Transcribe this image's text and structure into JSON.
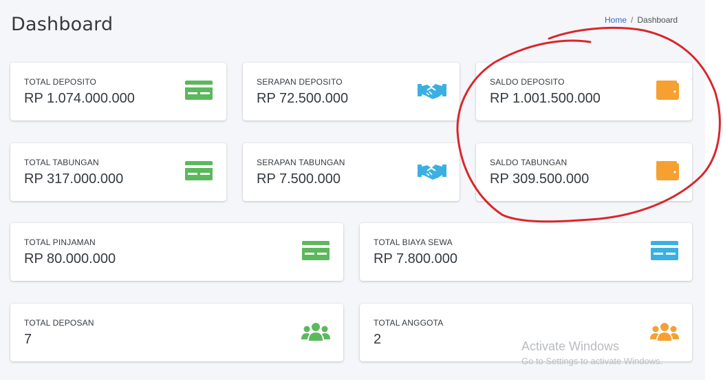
{
  "header": {
    "title": "Dashboard",
    "breadcrumb": {
      "home": "Home",
      "separator": "/",
      "current": "Dashboard"
    }
  },
  "colors": {
    "green": "#5cb85c",
    "blue": "#3ab0e2",
    "orange": "#f5a030",
    "annotation": "#d9262c"
  },
  "cards": [
    {
      "label": "TOTAL DEPOSITO",
      "value": "RP 1.074.000.000",
      "icon": "credit-card-icon",
      "icon_color": "green"
    },
    {
      "label": "SERAPAN DEPOSITO",
      "value": "RP 72.500.000",
      "icon": "handshake-icon",
      "icon_color": "blue"
    },
    {
      "label": "SALDO DEPOSITO",
      "value": "RP 1.001.500.000",
      "icon": "wallet-icon",
      "icon_color": "orange"
    },
    {
      "label": "TOTAL TABUNGAN",
      "value": "RP 317.000.000",
      "icon": "credit-card-icon",
      "icon_color": "green"
    },
    {
      "label": "SERAPAN TABUNGAN",
      "value": "RP 7.500.000",
      "icon": "handshake-icon",
      "icon_color": "blue"
    },
    {
      "label": "SALDO TABUNGAN",
      "value": "RP 309.500.000",
      "icon": "wallet-icon",
      "icon_color": "orange"
    },
    {
      "label": "TOTAL PINJAMAN",
      "value": "RP 80.000.000",
      "icon": "credit-card-icon",
      "icon_color": "green"
    },
    {
      "label": "TOTAL BIAYA SEWA",
      "value": "RP 7.800.000",
      "icon": "credit-card-icon",
      "icon_color": "blue"
    },
    {
      "label": "TOTAL DEPOSAN",
      "value": "7",
      "icon": "users-icon",
      "icon_color": "green"
    },
    {
      "label": "TOTAL ANGGOTA",
      "value": "2",
      "icon": "users-icon",
      "icon_color": "orange"
    }
  ],
  "watermark": {
    "line1": "Activate Windows",
    "line2": "Go to Settings to activate Windows."
  }
}
